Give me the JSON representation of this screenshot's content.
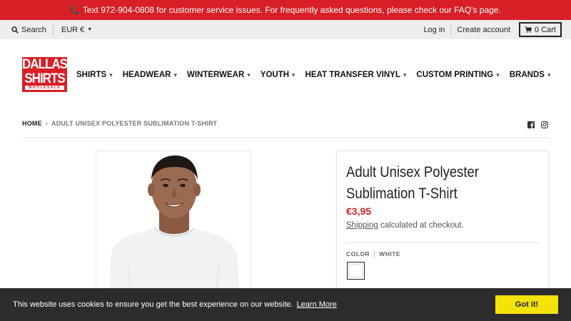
{
  "announcement": {
    "phone_icon": "phone-icon",
    "text": "Text 972-904-0808 for customer service issues. For frequently asked questions, please check our FAQ's page."
  },
  "topbar": {
    "search_label": "Search",
    "currency": "EUR €",
    "login": "Log in",
    "create_account": "Create account",
    "cart_label": "0 Cart"
  },
  "logo": {
    "line1": "DALLAS",
    "line2": "SHIRTS",
    "line3": "WHOLESALE"
  },
  "nav": {
    "items": [
      {
        "label": "SHIRTS"
      },
      {
        "label": "HEADWEAR"
      },
      {
        "label": "WINTERWEAR"
      },
      {
        "label": "YOUTH"
      },
      {
        "label": "HEAT TRANSFER VINYL"
      },
      {
        "label": "CUSTOM PRINTING"
      },
      {
        "label": "BRANDS"
      }
    ]
  },
  "breadcrumb": {
    "home": "HOME",
    "separator": "›",
    "current": "ADULT UNISEX POLYESTER SUBLIMATION T-SHIRT"
  },
  "product": {
    "title": "Adult Unisex Polyester Sublimation T-Shirt",
    "price": "€3,95",
    "shipping_link": "Shipping",
    "shipping_rest": " calculated at checkout.",
    "color_label": "COLOR",
    "color_value": "WHITE"
  },
  "cookie": {
    "message": "This website uses cookies to ensure you get the best experience on our website.",
    "learn_more": "Learn More",
    "accept": "Got it!"
  },
  "colors": {
    "brand_red": "#d81f26",
    "cookie_bg": "#2c2c2c",
    "accept_yellow": "#f5e20a"
  }
}
